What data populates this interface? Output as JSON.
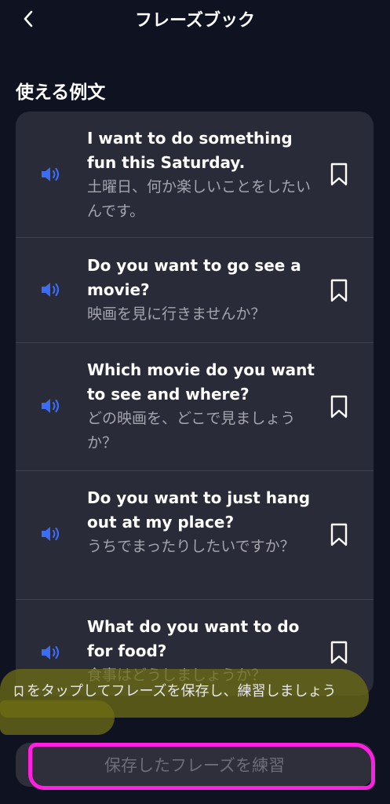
{
  "header": {
    "title": "フレーズブック"
  },
  "section": {
    "title": "使える例文"
  },
  "phrases": [
    {
      "en": "I want to do something fun this Saturday.",
      "ja": "土曜日、何か楽しいことをしたいんです。"
    },
    {
      "en": "Do you want to go see a movie?",
      "ja": "映画を見に行きませんか？"
    },
    {
      "en": "Which movie do you want to see and where?",
      "ja": "どの映画を、どこで見ましょうか？"
    },
    {
      "en": "Do you want to just hang out at my place?",
      "ja": "うちでまったりしたいですか？"
    },
    {
      "en": "What do you want to do for food?",
      "ja": "食事はどうしましょうか？"
    }
  ],
  "hint": {
    "text": "をタップしてフレーズを保存し、練習しましょう"
  },
  "practice_button": {
    "label": "保存したフレーズを練習"
  },
  "colors": {
    "background": "#0f1220",
    "card": "#2a2b38",
    "speaker": "#3b6cf6",
    "annotation_highlight": "#6e6e14",
    "annotation_ring": "#ff1fe1"
  }
}
